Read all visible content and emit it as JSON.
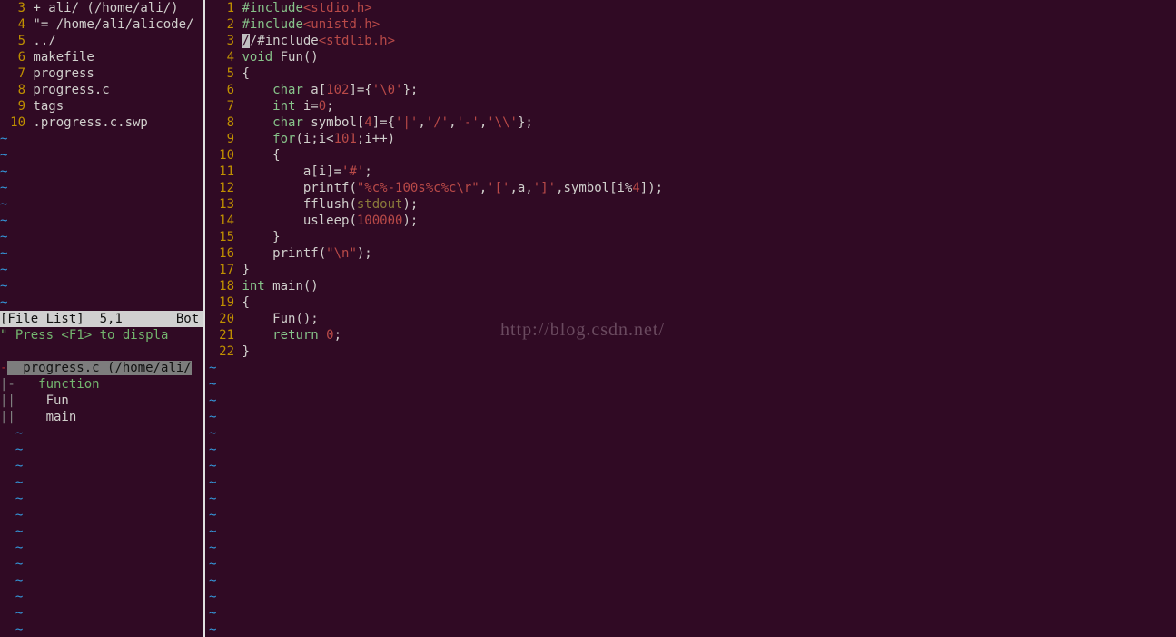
{
  "file_list": {
    "lines": [
      {
        "num": "3",
        "prefix": " + ",
        "path": "ali/",
        "suffix": " (/home/ali/)"
      },
      {
        "num": "4",
        "prefix": " \"= ",
        "path": "/home/ali/alicode/",
        "suffix": ""
      },
      {
        "num": "5",
        "prefix": " ",
        "path": "../",
        "suffix": ""
      },
      {
        "num": "6",
        "prefix": " ",
        "path": "makefile",
        "suffix": ""
      },
      {
        "num": "7",
        "prefix": " ",
        "path": "progress",
        "suffix": ""
      },
      {
        "num": "8",
        "prefix": " ",
        "path": "progress.c",
        "suffix": ""
      },
      {
        "num": "9",
        "prefix": " ",
        "path": "tags",
        "suffix": ""
      },
      {
        "num": "10",
        "prefix": " ",
        "path": ".progress.c.swp",
        "suffix": ""
      }
    ],
    "status_left": "[File List]  5,1",
    "status_right": "Bot",
    "hint": "\" Press <F1> to displa"
  },
  "taglist": {
    "header": "  progress.c (/home/ali/",
    "kind_prefix": "|-",
    "kind": "   function",
    "items": [
      {
        "prefix": "||",
        "label": "    Fun"
      },
      {
        "prefix": "||",
        "label": "    main"
      }
    ]
  },
  "code": {
    "lines": [
      {
        "n": "1",
        "t": [
          [
            "kw",
            "#include"
          ],
          [
            "str",
            "<stdio.h>"
          ]
        ]
      },
      {
        "n": "2",
        "t": [
          [
            "kw",
            "#include"
          ],
          [
            "str",
            "<unistd.h>"
          ]
        ]
      },
      {
        "n": "3",
        "t": [
          [
            "cursor",
            "/"
          ],
          [
            "txt",
            "/#include"
          ],
          [
            "str",
            "<stdlib.h>"
          ]
        ]
      },
      {
        "n": "4",
        "t": [
          [
            "kw",
            "void"
          ],
          [
            "txt",
            " Fun()"
          ]
        ]
      },
      {
        "n": "5",
        "t": [
          [
            "txt",
            "{"
          ]
        ]
      },
      {
        "n": "6",
        "t": [
          [
            "txt",
            "    "
          ],
          [
            "kw",
            "char"
          ],
          [
            "txt",
            " a["
          ],
          [
            "num",
            "102"
          ],
          [
            "txt",
            "]={"
          ],
          [
            "str",
            "'\\0'"
          ],
          [
            "txt",
            "};"
          ]
        ]
      },
      {
        "n": "7",
        "t": [
          [
            "txt",
            "    "
          ],
          [
            "kw",
            "int"
          ],
          [
            "txt",
            " i="
          ],
          [
            "num",
            "0"
          ],
          [
            "txt",
            ";"
          ]
        ]
      },
      {
        "n": "8",
        "t": [
          [
            "txt",
            "    "
          ],
          [
            "kw",
            "char"
          ],
          [
            "txt",
            " symbol["
          ],
          [
            "num",
            "4"
          ],
          [
            "txt",
            "]={"
          ],
          [
            "str",
            "'|'"
          ],
          [
            "txt",
            ","
          ],
          [
            "str",
            "'/'"
          ],
          [
            "txt",
            ","
          ],
          [
            "str",
            "'-'"
          ],
          [
            "txt",
            ","
          ],
          [
            "str",
            "'\\\\'"
          ],
          [
            "txt",
            "};"
          ]
        ]
      },
      {
        "n": "9",
        "t": [
          [
            "txt",
            "    "
          ],
          [
            "kw",
            "for"
          ],
          [
            "txt",
            "(i;i<"
          ],
          [
            "num",
            "101"
          ],
          [
            "txt",
            ";i++)"
          ]
        ]
      },
      {
        "n": "10",
        "t": [
          [
            "txt",
            "    {"
          ]
        ]
      },
      {
        "n": "11",
        "t": [
          [
            "txt",
            "        a[i]="
          ],
          [
            "str",
            "'#'"
          ],
          [
            "txt",
            ";"
          ]
        ]
      },
      {
        "n": "12",
        "t": [
          [
            "txt",
            "        printf("
          ],
          [
            "str",
            "\"%c%-100s%c%c\\r\""
          ],
          [
            "txt",
            ","
          ],
          [
            "str",
            "'['"
          ],
          [
            "txt",
            ",a,"
          ],
          [
            "str",
            "']'"
          ],
          [
            "txt",
            ",symbol[i%"
          ],
          [
            "num",
            "4"
          ],
          [
            "txt",
            "]);"
          ]
        ]
      },
      {
        "n": "13",
        "t": [
          [
            "txt",
            "        fflush("
          ],
          [
            "stdout",
            "stdout"
          ],
          [
            "txt",
            ");"
          ]
        ]
      },
      {
        "n": "14",
        "t": [
          [
            "txt",
            "        usleep("
          ],
          [
            "num",
            "100000"
          ],
          [
            "txt",
            ");"
          ]
        ]
      },
      {
        "n": "15",
        "t": [
          [
            "txt",
            "    }"
          ]
        ]
      },
      {
        "n": "16",
        "t": [
          [
            "txt",
            "    printf("
          ],
          [
            "str",
            "\"\\n\""
          ],
          [
            "txt",
            ");"
          ]
        ]
      },
      {
        "n": "17",
        "t": [
          [
            "txt",
            "}"
          ]
        ]
      },
      {
        "n": "18",
        "t": [
          [
            "kw",
            "int"
          ],
          [
            "txt",
            " main()"
          ]
        ]
      },
      {
        "n": "19",
        "t": [
          [
            "txt",
            "{"
          ]
        ]
      },
      {
        "n": "20",
        "t": [
          [
            "txt",
            "    Fun();"
          ]
        ]
      },
      {
        "n": "21",
        "t": [
          [
            "txt",
            "    "
          ],
          [
            "kw",
            "return"
          ],
          [
            "txt",
            " "
          ],
          [
            "num",
            "0"
          ],
          [
            "txt",
            ";"
          ]
        ]
      },
      {
        "n": "22",
        "t": [
          [
            "txt",
            "}"
          ]
        ]
      }
    ]
  },
  "watermark": "http://blog.csdn.net/",
  "dash": "-"
}
